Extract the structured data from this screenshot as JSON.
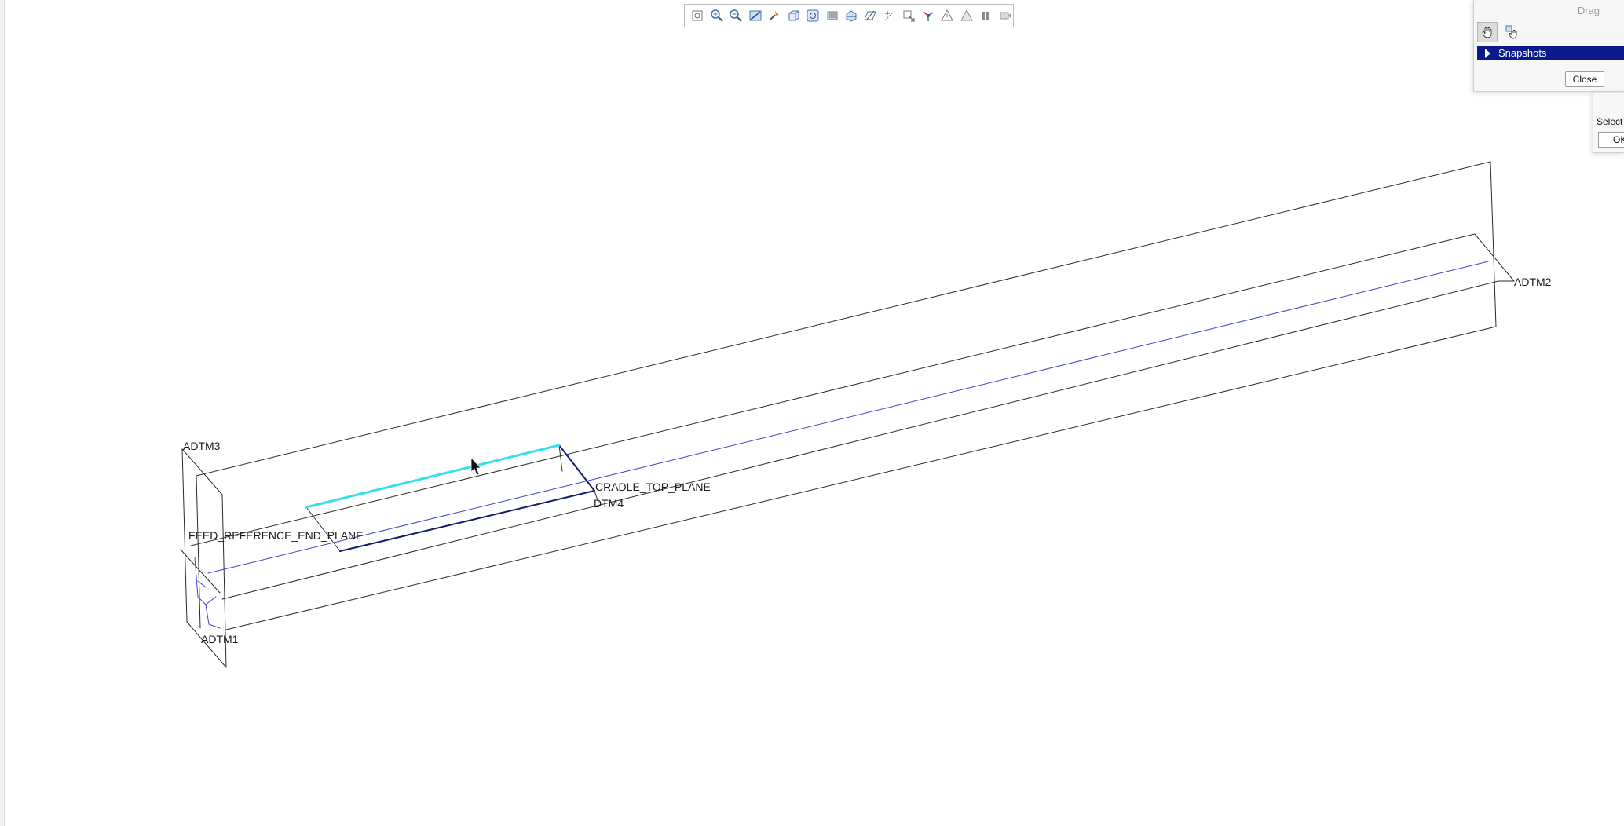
{
  "toolbar": {
    "icons": [
      "refit-icon",
      "zoom-in-icon",
      "zoom-out-icon",
      "repaint-icon",
      "spin-center-icon",
      "saved-orientations-icon",
      "view-manager-icon",
      "display-style-icon",
      "section-icon",
      "datum-planes-icon",
      "datum-axes-icon",
      "point-display-icon",
      "csys-display-icon",
      "annotation-display-icon",
      "triangle-warning-icon",
      "pause-icon",
      "next-step-icon"
    ]
  },
  "viewport": {
    "datum_labels": {
      "adtm3": "ADTM3",
      "adtm2": "ADTM2",
      "adtm1": "ADTM1",
      "dtm4": "DTM4",
      "cradle_top_plane": "CRADLE_TOP_PLANE",
      "feed_reference_end_plane": "FEED_REFERENCE_END_PLANE"
    },
    "colors": {
      "edge": "#2a2a2a",
      "axis": "#3b46c8",
      "highlight": "#33e0ee",
      "selected": "#141a6e"
    }
  },
  "drag_dialog": {
    "title": "Drag",
    "snapshots_label": "Snapshots",
    "close_label": "Close",
    "icons": [
      "drag-hand-icon",
      "drag-component-icon"
    ]
  },
  "select_dialog": {
    "label": "Select",
    "ok_label": "OK"
  }
}
